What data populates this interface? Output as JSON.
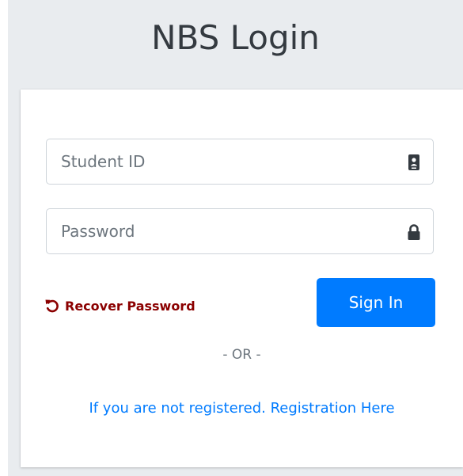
{
  "header": {
    "title": "NBS Login"
  },
  "form": {
    "student_id": {
      "placeholder": "Student ID",
      "value": "",
      "icon": "id-badge-icon"
    },
    "password": {
      "placeholder": "Password",
      "value": "",
      "icon": "lock-icon"
    },
    "recover_label": "Recover Password",
    "recover_icon": "undo-icon",
    "signin_label": "Sign In",
    "separator": "- OR -",
    "register_link": "If you are not registered. Registration Here"
  },
  "colors": {
    "background": "#e9ecef",
    "card": "#ffffff",
    "primary": "#007bff",
    "recover": "#8b0000",
    "title": "#343a40"
  }
}
